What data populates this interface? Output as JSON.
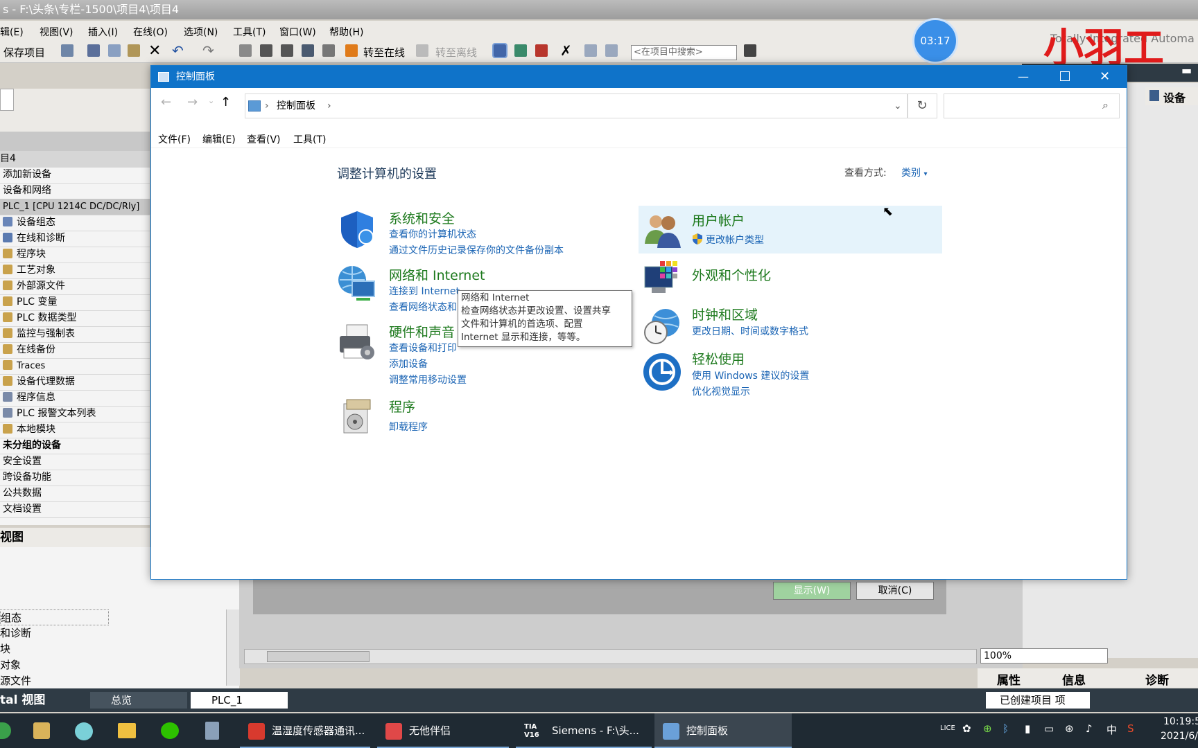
{
  "tia": {
    "title": "s - F:\\头条\\专栏-1500\\项目4\\项目4",
    "menu": [
      "辑(E)",
      "视图(V)",
      "插入(I)",
      "在线(O)",
      "选项(N)",
      "工具(T)",
      "窗口(W)",
      "帮助(H)"
    ],
    "save_label": "保存项目",
    "go_online": "转至在线",
    "go_offline": "转至离线",
    "search_placeholder": "<在项目中搜索>",
    "timer": "03:17",
    "watermark": "小羽工控",
    "watermark_sub": "Totally Integrated Automa",
    "right_panel_tab": "设备",
    "tree": [
      "目4",
      "添加新设备",
      "设备和网络",
      "PLC_1 [CPU 1214C DC/DC/Rly]",
      "设备组态",
      "在线和诊断",
      "程序块",
      "工艺对象",
      "外部源文件",
      "PLC 变量",
      "PLC 数据类型",
      "监控与强制表",
      "在线备份",
      "Traces",
      "设备代理数据",
      "程序信息",
      "PLC 报警文本列表",
      "本地模块",
      "未分组的设备",
      "安全设置",
      "跨设备功能",
      "公共数据",
      "文档设置"
    ],
    "details_title": "视图",
    "details_rows": [
      "组态",
      "和诊断",
      "块",
      "对象",
      "源文件"
    ],
    "btn_show": "显示(W)",
    "btn_cancel": "取消(C)",
    "zoom": "100%",
    "inspector_tabs": [
      "属性",
      "信息",
      "诊断"
    ],
    "portal_view": "tal 视图",
    "overview": "总览",
    "plc_tab": "PLC_1",
    "status_text": "已创建项目 项"
  },
  "cp": {
    "title": "控制面板",
    "breadcrumb": "控制面板",
    "menu": [
      "文件(F)",
      "编辑(E)",
      "查看(V)",
      "工具(T)"
    ],
    "heading": "调整计算机的设置",
    "view_by_label": "查看方式:",
    "view_by_value": "类别",
    "categories_left": [
      {
        "title": "系统和安全",
        "links": [
          "查看你的计算机状态",
          "通过文件历史记录保存你的文件备份副本"
        ]
      },
      {
        "title": "网络和 Internet",
        "links": [
          "连接到 Internet",
          "查看网络状态和"
        ]
      },
      {
        "title": "硬件和声音",
        "links": [
          "查看设备和打印",
          "添加设备",
          "调整常用移动设置"
        ]
      },
      {
        "title": "程序",
        "links": [
          "卸载程序"
        ]
      }
    ],
    "categories_right": [
      {
        "title": "用户帐户",
        "links": [
          "更改帐户类型"
        ]
      },
      {
        "title": "外观和个性化",
        "links": []
      },
      {
        "title": "时钟和区域",
        "links": [
          "更改日期、时间或数字格式"
        ]
      },
      {
        "title": "轻松使用",
        "links": [
          "使用 Windows 建议的设置",
          "优化视觉显示"
        ]
      }
    ],
    "tooltip": [
      "网络和 Internet",
      "检查网络状态并更改设置、设置共享",
      "文件和计算机的首选项、配置",
      "Internet 显示和连接，等等。"
    ]
  },
  "taskbar": {
    "apps": [
      "温湿度传感器通讯...",
      "无他伴侣",
      "Siemens - F:\\头...",
      "控制面板"
    ],
    "tia_icon": "TIA V16",
    "time": "10:19:5",
    "date": "2021/6/",
    "ime": "中"
  }
}
